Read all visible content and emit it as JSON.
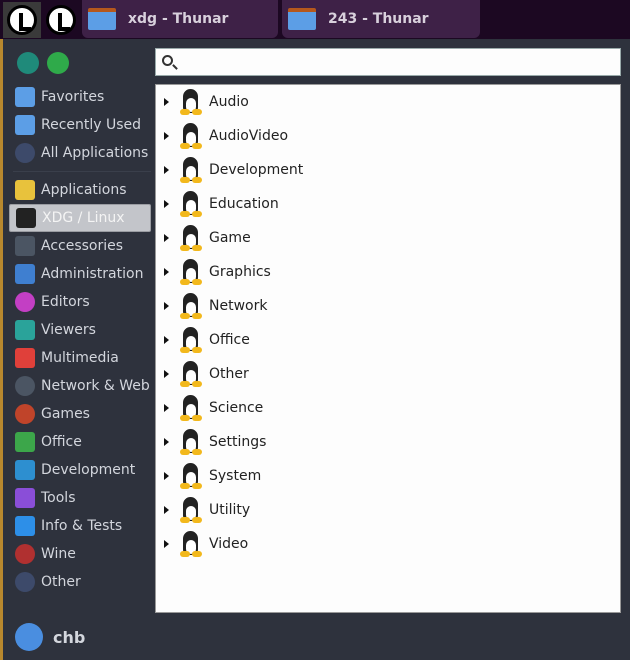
{
  "taskbar": {
    "tasks": [
      {
        "label": "xdg - Thunar",
        "icon": "folder-icon"
      },
      {
        "label": "243 - Thunar",
        "icon": "folder-icon"
      }
    ]
  },
  "search": {
    "placeholder": "",
    "value": ""
  },
  "sidebar": {
    "items": [
      {
        "label": "Favorites",
        "icon": "favorites-folder-icon",
        "color": "#5c9ee6"
      },
      {
        "label": "Recently Used",
        "icon": "recent-folder-icon",
        "color": "#5c9ee6"
      },
      {
        "label": "All Applications",
        "icon": "dots-icon",
        "color": "#3d4a6a"
      },
      {
        "label": "Applications",
        "icon": "grid-icon",
        "color": "#e8c23c"
      },
      {
        "label": "XDG / Linux",
        "icon": "tux-icon",
        "color": "#222222",
        "selected": true
      },
      {
        "label": "Accessories",
        "icon": "accessories-icon",
        "color": "#4b5563"
      },
      {
        "label": "Administration",
        "icon": "administration-icon",
        "color": "#3f7fd0"
      },
      {
        "label": "Editors",
        "icon": "editors-icon",
        "color": "#c33fc4"
      },
      {
        "label": "Viewers",
        "icon": "viewers-icon",
        "color": "#2aa39a"
      },
      {
        "label": "Multimedia",
        "icon": "multimedia-icon",
        "color": "#e0403a"
      },
      {
        "label": "Network & Web",
        "icon": "globe-icon",
        "color": "#4b5563"
      },
      {
        "label": "Games",
        "icon": "games-icon",
        "color": "#c0442a"
      },
      {
        "label": "Office",
        "icon": "office-icon",
        "color": "#3ca64a"
      },
      {
        "label": "Development",
        "icon": "development-icon",
        "color": "#2d8fd0"
      },
      {
        "label": "Tools",
        "icon": "tools-icon",
        "color": "#8a4ed8"
      },
      {
        "label": "Info & Tests",
        "icon": "info-icon",
        "color": "#2d8fe8"
      },
      {
        "label": "Wine",
        "icon": "wine-icon",
        "color": "#b03030"
      },
      {
        "label": "Other",
        "icon": "dots-icon",
        "color": "#3d4a6a"
      }
    ]
  },
  "categories": [
    "Audio",
    "AudioVideo",
    "Development",
    "Education",
    "Game",
    "Graphics",
    "Network",
    "Office",
    "Other",
    "Science",
    "Settings",
    "System",
    "Utility",
    "Video"
  ],
  "user": {
    "name": "chb"
  }
}
